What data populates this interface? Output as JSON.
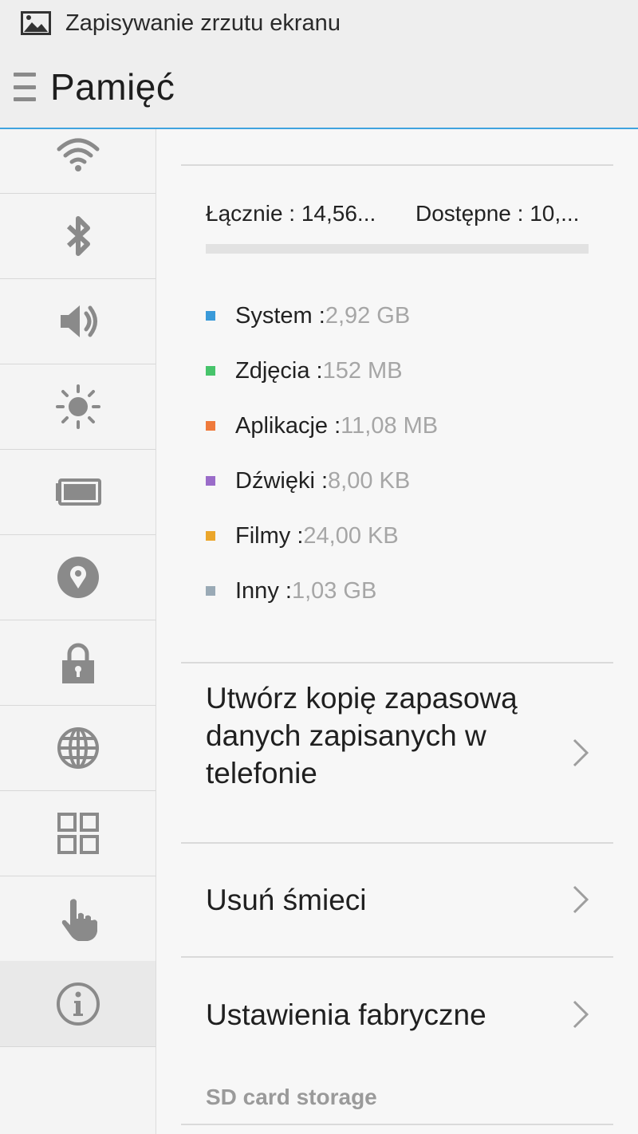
{
  "status_bar": {
    "notification_icon": "image-icon",
    "notification_text": "Zapisywanie zrzutu ekranu"
  },
  "app_bar": {
    "menu_icon": "hamburger-icon",
    "title": "Pamięć"
  },
  "sidebar": {
    "items": [
      {
        "icon": "wifi-icon",
        "active": false
      },
      {
        "icon": "bluetooth-icon",
        "active": false
      },
      {
        "icon": "volume-icon",
        "active": false
      },
      {
        "icon": "brightness-icon",
        "active": false
      },
      {
        "icon": "battery-icon",
        "active": false
      },
      {
        "icon": "location-icon",
        "active": false
      },
      {
        "icon": "lock-icon",
        "active": false
      },
      {
        "icon": "globe-icon",
        "active": false
      },
      {
        "icon": "apps-grid-icon",
        "active": false
      },
      {
        "icon": "gesture-hand-icon",
        "active": false
      },
      {
        "icon": "info-icon",
        "active": true
      }
    ]
  },
  "storage": {
    "total": "Łącznie : 14,56...",
    "available": "Dostępne : 10,...",
    "legend": [
      {
        "label": "System : ",
        "value": "2,92 GB",
        "color": "#3a9ad9"
      },
      {
        "label": "Zdjęcia : ",
        "value": "152 MB",
        "color": "#47c46b"
      },
      {
        "label": "Aplikacje : ",
        "value": "11,08 MB",
        "color": "#ef7a3c"
      },
      {
        "label": "Dźwięki : ",
        "value": "8,00 KB",
        "color": "#9a6cc9"
      },
      {
        "label": "Filmy : ",
        "value": "24,00 KB",
        "color": "#eba62b"
      },
      {
        "label": "Inny : ",
        "value": "1,03 GB",
        "color": "#9aaab6"
      }
    ]
  },
  "menu": {
    "backup": "Utwórz kopię zapasową danych zapisanych w telefonie",
    "clean": "Usuń śmieci",
    "factory": "Ustawienia fabryczne"
  },
  "sd_section": {
    "header": "SD card storage"
  },
  "colors": {
    "accent": "#3fa3df",
    "app_bar_bg": "#eeeeee",
    "icon_gray": "#8a8a8a"
  }
}
